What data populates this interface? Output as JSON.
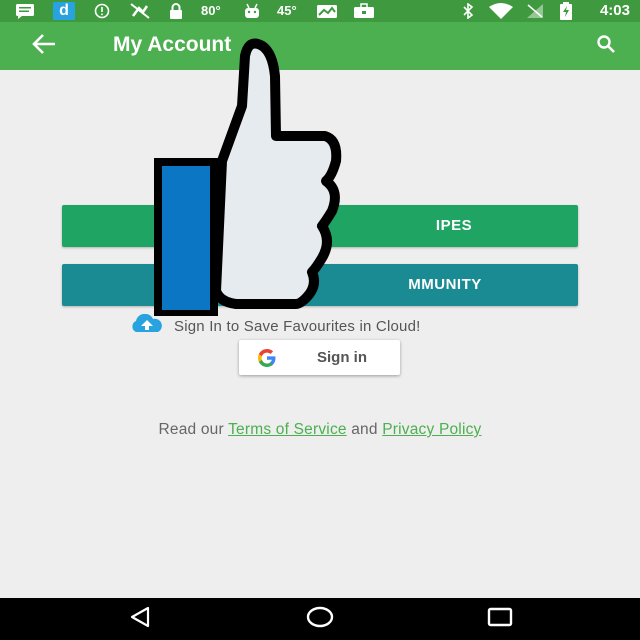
{
  "status_bar": {
    "temp1": "80°",
    "temp2": "45°",
    "time": "4:03",
    "icons": [
      "message-icon",
      "d-app-icon",
      "info-icon",
      "no-gps-icon",
      "lock-icon",
      "android-icon",
      "photo-icon",
      "briefcase-icon",
      "bluetooth-icon",
      "wifi-icon",
      "no-signal-icon",
      "battery-charging-icon"
    ]
  },
  "app_bar": {
    "title": "My Account",
    "back_icon": "arrow-back-icon",
    "search_icon": "search-icon",
    "color": "#4caf50"
  },
  "buttons": {
    "recipes_label": "IPES",
    "community_label": "MMUNITY",
    "recipes_color": "#1fa463",
    "community_color": "#1a8a93"
  },
  "cloud": {
    "icon": "cloud-upload-icon",
    "text": "Sign In to Save Favourites in Cloud!"
  },
  "signin": {
    "label": "Sign in",
    "icon": "google-icon"
  },
  "terms": {
    "prefix": "Read our",
    "terms_link": "Terms of Service",
    "and": "and",
    "privacy_link": "Privacy Policy"
  },
  "overlay": {
    "icon": "thumbs-up-icon"
  },
  "nav_bar": {
    "back": "nav-back-icon",
    "home": "nav-home-icon",
    "recents": "nav-recents-icon"
  }
}
